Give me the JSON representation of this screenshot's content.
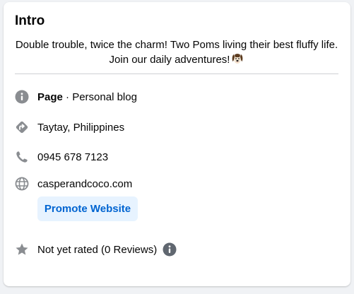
{
  "intro": {
    "title": "Intro",
    "bio": "Double trouble, twice the charm! Two Poms living their best fluffy life. Join our daily adventures!",
    "bio_emoji_icon": "dog-face-icon"
  },
  "details": {
    "category_label": "Page",
    "category_separator": " · ",
    "category_value": "Personal blog",
    "location": "Taytay, Philippines",
    "phone": "0945 678 7123",
    "website": "casperandcoco.com",
    "promote_button": "Promote Website",
    "rating": "Not yet rated (0 Reviews)"
  },
  "colors": {
    "link": "#0064d1",
    "icon_gray": "#8a8d91",
    "button_bg": "#e7f3ff",
    "divider": "#ced0d4"
  }
}
